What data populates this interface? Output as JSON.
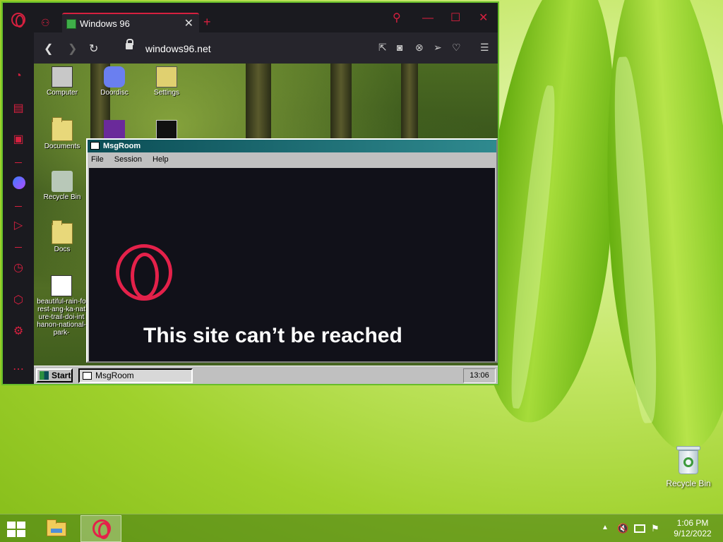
{
  "desktop": {
    "recycle_bin_label": "Recycle Bin"
  },
  "browser": {
    "tab_title": "Windows 96",
    "url": "windows96.net",
    "tab_close": "✕",
    "tab_add": "+"
  },
  "w96_desktop": {
    "icons": [
      {
        "label": "Computer"
      },
      {
        "label": "Doordisc"
      },
      {
        "label": "Settings"
      },
      {
        "label": "Documents"
      },
      {
        "label": "Recycle Bin"
      },
      {
        "label": "Docs"
      },
      {
        "label": "beautiful-rain-forest-ang-ka-nature-trail-doi-inthanon-national-park-"
      }
    ]
  },
  "msgroom": {
    "title": "MsgRoom",
    "menu": [
      "File",
      "Session",
      "Help"
    ],
    "error_text": "This site can’t be reached"
  },
  "w96_taskbar": {
    "start_label": "Start",
    "task_label": "MsgRoom",
    "clock": "13:06"
  },
  "taskbar": {
    "time": "1:06 PM",
    "date": "9/12/2022"
  },
  "colors": {
    "opera_red": "#e4214a",
    "window_border": "#67bd2a"
  }
}
